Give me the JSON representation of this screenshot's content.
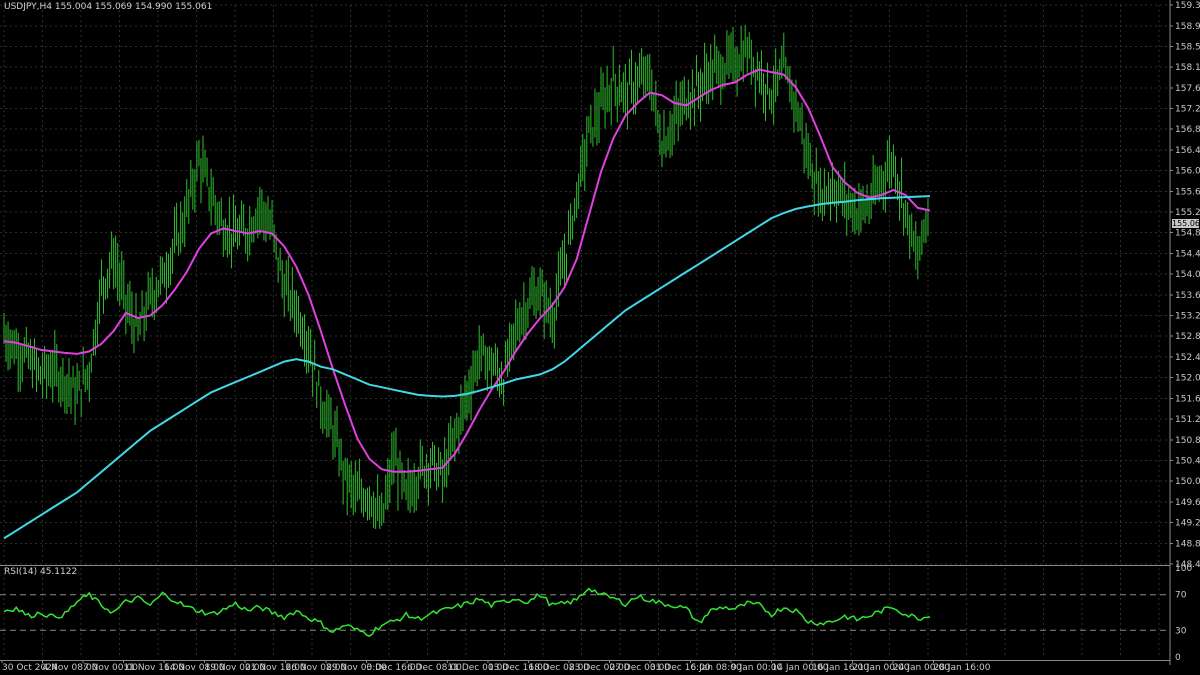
{
  "header": {
    "symbol": "USDJPY,H4",
    "ohlc": "155.004 155.069 154.990 155.061",
    "current_price": "155.061"
  },
  "rsi_header": {
    "name": "RSI(14)",
    "value": "45.1122"
  },
  "colors": {
    "background": "#000000",
    "grid": "#2e2e2e",
    "candles": "#2fbf2f",
    "ma_fast": "#e040e0",
    "ma_slow": "#40d8e8",
    "rsi_line": "#32e632",
    "axis_text": "#c8c8c8"
  },
  "chart_data": [
    {
      "type": "line",
      "title": "USDJPY,H4",
      "y_ticks": [
        "159.310",
        "158.900",
        "158.500",
        "158.100",
        "157.690",
        "157.290",
        "156.890",
        "156.480",
        "156.080",
        "155.670",
        "155.270",
        "154.870",
        "154.460",
        "154.060",
        "153.650",
        "153.250",
        "152.850",
        "152.440",
        "152.040",
        "151.630",
        "151.230",
        "150.820",
        "150.420",
        "150.020",
        "149.610",
        "149.210",
        "148.800",
        "148.400"
      ],
      "ylim": [
        148.4,
        159.31
      ],
      "x_ticks": [
        "30 Oct 2024",
        "4 Nov 08:00",
        "7 Nov 00:00",
        "11 Nov 16:00",
        "14 Nov 08:00",
        "19 Nov 00:00",
        "21 Nov 16:00",
        "26 Nov 08:00",
        "29 Nov 00:00",
        "3 Dec 16:00",
        "6 Dec 08:00",
        "11 Dec 00:00",
        "13 Dec 16:00",
        "18 Dec 08:00",
        "23 Dec 00:00",
        "27 Dec 00:00",
        "31 Dec 16:00",
        "6 Jan 08:00",
        "9 Jan 00:00",
        "14 Jan 00:00",
        "16 Jan 16:00",
        "21 Jan 00:00",
        "24 Jan 00:00",
        "28 Jan 16:00"
      ],
      "price_close": [
        152.9,
        152.6,
        152.4,
        152.1,
        152.2,
        152.0,
        151.7,
        152.2,
        153.8,
        154.4,
        153.5,
        152.9,
        153.6,
        154.0,
        154.6,
        155.3,
        156.3,
        155.6,
        155.0,
        154.8,
        154.9,
        155.4,
        154.9,
        153.8,
        153.4,
        152.7,
        151.6,
        151.0,
        150.1,
        149.7,
        149.8,
        149.2,
        150.5,
        149.7,
        150.2,
        150.4,
        150.1,
        150.9,
        151.7,
        152.5,
        152.3,
        152.0,
        153.0,
        153.5,
        153.7,
        153.2,
        154.3,
        155.6,
        156.8,
        157.3,
        157.8,
        157.6,
        157.8,
        157.9,
        156.6,
        157.0,
        157.5,
        157.7,
        158.0,
        158.1,
        158.2,
        158.4,
        158.0,
        157.6,
        158.0,
        157.4,
        156.3,
        155.6,
        155.8,
        155.5,
        155.3,
        155.4,
        155.9,
        156.3,
        155.3,
        154.3,
        155.5
      ],
      "series": [
        {
          "name": "",
          "values": [
            152.75,
            152.72,
            152.65,
            152.58,
            152.55,
            152.52,
            152.5,
            152.55,
            152.7,
            152.95,
            153.3,
            153.2,
            153.25,
            153.45,
            153.75,
            154.1,
            154.55,
            154.85,
            154.95,
            154.9,
            154.85,
            154.9,
            154.85,
            154.6,
            154.2,
            153.65,
            152.95,
            152.2,
            151.5,
            150.85,
            150.45,
            150.25,
            150.2,
            150.2,
            150.22,
            150.25,
            150.28,
            150.55,
            150.95,
            151.4,
            151.8,
            152.15,
            152.55,
            152.9,
            153.2,
            153.45,
            153.8,
            154.35,
            155.2,
            156.05,
            156.7,
            157.15,
            157.4,
            157.6,
            157.55,
            157.4,
            157.35,
            157.5,
            157.65,
            157.75,
            157.8,
            157.95,
            158.05,
            158.0,
            157.95,
            157.7,
            157.3,
            156.75,
            156.15,
            155.85,
            155.65,
            155.55,
            155.6,
            155.7,
            155.6,
            155.35,
            155.3
          ]
        },
        {
          "name": "",
          "values": [
            148.9,
            149.05,
            149.2,
            149.35,
            149.5,
            149.65,
            149.8,
            150.0,
            150.2,
            150.4,
            150.6,
            150.8,
            151.0,
            151.15,
            151.3,
            151.45,
            151.6,
            151.75,
            151.85,
            151.95,
            152.05,
            152.15,
            152.25,
            152.35,
            152.4,
            152.35,
            152.25,
            152.2,
            152.1,
            152.0,
            151.9,
            151.85,
            151.8,
            151.75,
            151.7,
            151.68,
            151.67,
            151.68,
            151.72,
            151.78,
            151.85,
            151.92,
            152.0,
            152.05,
            152.1,
            152.2,
            152.35,
            152.55,
            152.75,
            152.95,
            153.15,
            153.35,
            153.5,
            153.65,
            153.8,
            153.95,
            154.1,
            154.25,
            154.4,
            154.55,
            154.7,
            154.85,
            155.0,
            155.15,
            155.25,
            155.33,
            155.38,
            155.42,
            155.45,
            155.47,
            155.5,
            155.52,
            155.54,
            155.55,
            155.56,
            155.57,
            155.58
          ]
        }
      ]
    },
    {
      "type": "line",
      "title": "RSI(14) 45.1122",
      "ylim": [
        0,
        100
      ],
      "y_ticks": [
        "100",
        "70",
        "30",
        "0"
      ],
      "levels": [
        70,
        30
      ],
      "values": [
        52,
        55,
        46,
        50,
        45,
        48,
        62,
        70,
        58,
        50,
        62,
        66,
        58,
        71,
        64,
        56,
        52,
        48,
        53,
        60,
        52,
        56,
        50,
        45,
        52,
        44,
        38,
        28,
        36,
        30,
        26,
        36,
        40,
        47,
        43,
        48,
        52,
        56,
        60,
        65,
        58,
        62,
        66,
        62,
        70,
        58,
        60,
        64,
        78,
        70,
        66,
        60,
        68,
        64,
        60,
        58,
        54,
        38,
        52,
        56,
        54,
        60,
        58,
        48,
        56,
        52,
        40,
        38,
        40,
        46,
        42,
        46,
        52,
        56,
        48,
        44,
        45.1
      ]
    }
  ]
}
